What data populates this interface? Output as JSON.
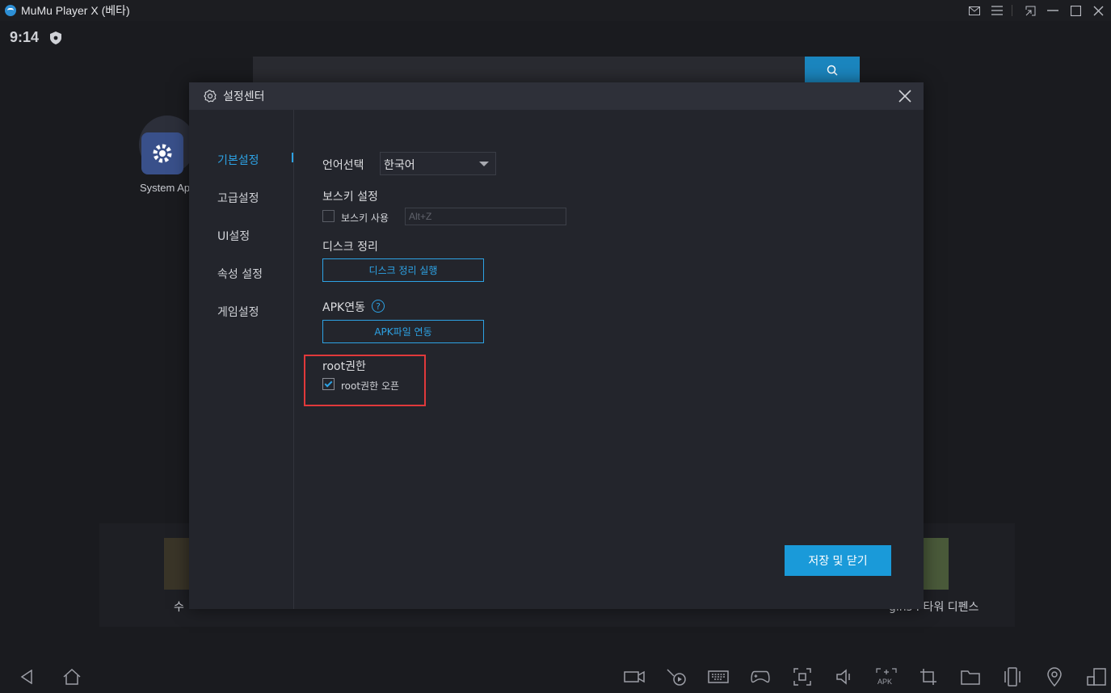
{
  "titlebar": {
    "app_title": "MuMu Player X (베타)",
    "controls": [
      "mail-icon",
      "menu-icon",
      "shrink-icon",
      "minimize-icon",
      "maximize-icon",
      "close-icon"
    ]
  },
  "status": {
    "time": "9:14"
  },
  "home": {
    "app_label": "System Ap",
    "games": [
      {
        "label": "수"
      },
      {
        "label": "gins : 타워 디펜스"
      }
    ]
  },
  "dialog": {
    "title": "설정센터",
    "sidebar": [
      {
        "label": "기본설정",
        "active": true
      },
      {
        "label": "고급설정"
      },
      {
        "label": "UI설정"
      },
      {
        "label": "속성 설정"
      },
      {
        "label": "게임설정"
      }
    ],
    "language": {
      "label": "언어선택",
      "value": "한국어"
    },
    "hotkey": {
      "section": "보스키 설정",
      "checkbox_label": "보스키 사용",
      "checked": false,
      "placeholder": "Alt+Z"
    },
    "disk": {
      "section": "디스크 정리",
      "button": "디스크 정리 실행"
    },
    "apk": {
      "section": "APK연동",
      "help": "?",
      "button": "APK파일 연동"
    },
    "root": {
      "section": "root권한",
      "checkbox_label": "root권한 오픈",
      "checked": true
    },
    "save_button": "저장 및 닫기"
  },
  "colors": {
    "accent": "#2da2e4",
    "highlight": "#e0393b",
    "save": "#1a9ad9"
  }
}
